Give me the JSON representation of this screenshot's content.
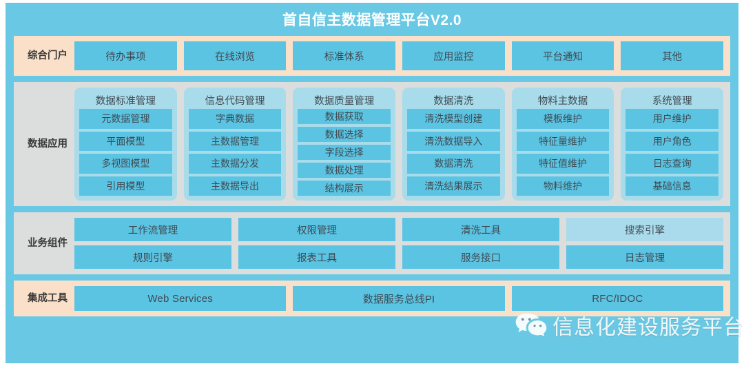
{
  "title": "首自信主数据管理平台V2.0",
  "colors": {
    "frame_blue": "#69c9e4",
    "band_peach": "#fae0c8",
    "band_gray": "#dcdddd",
    "item_blue": "#5bc4e3",
    "card_blue": "#a8dceb",
    "highlight_blue": "#aadbec",
    "text_dark": "#3f4a52",
    "title_white": "#ffffff"
  },
  "rows": {
    "portal": {
      "label": "综合门户",
      "items": [
        "待办事项",
        "在线浏览",
        "标准体系",
        "应用监控",
        "平台通知",
        "其他"
      ]
    },
    "data_application": {
      "label": "数据应用",
      "columns": [
        {
          "title": "数据标准管理",
          "items": [
            "元数据管理",
            "平面模型",
            "多视图模型",
            "引用模型"
          ]
        },
        {
          "title": "信息代码管理",
          "items": [
            "字典数据",
            "主数据管理",
            "主数据分发",
            "主数据导出"
          ]
        },
        {
          "title": "数据质量管理",
          "items": [
            "数据获取",
            "数据选择",
            "字段选择",
            "数据处理",
            "结构展示"
          ]
        },
        {
          "title": "数据清洗",
          "items": [
            "清洗模型创建",
            "清洗数据导入",
            "数据清洗",
            "清洗结果展示"
          ]
        },
        {
          "title": "物料主数据",
          "items": [
            "模板维护",
            "特征量维护",
            "特征值维护",
            "物料维护"
          ]
        },
        {
          "title": "系统管理",
          "items": [
            "用户维护",
            "用户角色",
            "日志查询",
            "基础信息"
          ]
        }
      ]
    },
    "business_components": {
      "label": "业务组件",
      "columns": [
        {
          "top": "工作流管理",
          "bottom": "规则引擎",
          "top_highlight": false
        },
        {
          "top": "权限管理",
          "bottom": "报表工具",
          "top_highlight": false
        },
        {
          "top": "清洗工具",
          "bottom": "服务接口",
          "top_highlight": false
        },
        {
          "top": "搜索引擎",
          "bottom": "日志管理",
          "top_highlight": true
        }
      ]
    },
    "integration_tools": {
      "label": "集成工具",
      "items": [
        "Web Services",
        "数据服务总线PI",
        "RFC/IDOC"
      ]
    }
  },
  "watermark": {
    "icon": "wechat-icon",
    "text": "信息化建设服务平台"
  }
}
